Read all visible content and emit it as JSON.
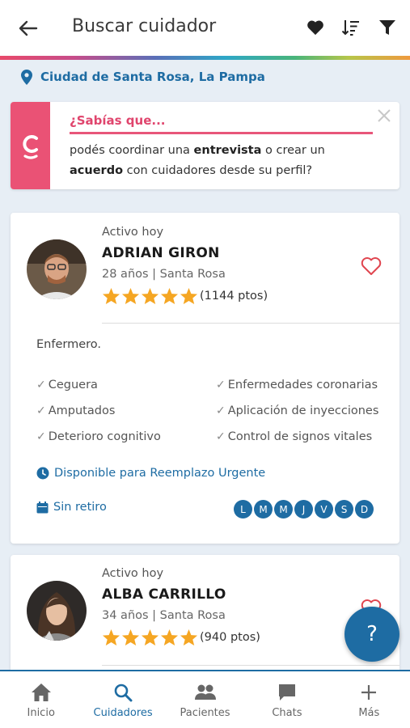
{
  "header": {
    "title": "Buscar cuidador",
    "back_icon": "arrow-left-icon",
    "icons": [
      "heart-icon",
      "sort-icon",
      "filter-icon"
    ]
  },
  "location": {
    "text": "Ciudad de Santa Rosa, La Pampa",
    "icon": "map-pin-icon"
  },
  "tip": {
    "title": "¿Sabías que...",
    "text_1": "podés coordinar una ",
    "bold_1": "entrevista",
    "text_2": " o crear un",
    "bold_2": "acuerdo",
    "text_3": " con cuidadores desde su perfil?",
    "brand_letter": "c"
  },
  "caregivers": [
    {
      "status": "Activo hoy",
      "name": "ADRIAN GIRON",
      "meta": "28 años | Santa Rosa",
      "rating": 5,
      "points": "(1144 ptos)",
      "profession": "Enfermero.",
      "skills_left": [
        "Ceguera",
        "Amputados",
        "Deterioro cognitivo"
      ],
      "skills_right": [
        "Enfermedades coronarias",
        "Aplicación de inyecciones",
        "Control de signos vitales"
      ],
      "urgent": "Disponible para Reemplazo Urgente",
      "retiro": "Sin retiro",
      "days": [
        "L",
        "M",
        "M",
        "J",
        "V",
        "S",
        "D"
      ]
    },
    {
      "status": "Activo hoy",
      "name": "ALBA CARRILLO",
      "meta": "34 años | Santa Rosa",
      "rating": 5,
      "points": "(940 ptos)"
    }
  ],
  "fab": {
    "label": "?"
  },
  "nav": [
    {
      "label": "Inicio",
      "icon": "home-icon",
      "active": false
    },
    {
      "label": "Cuidadores",
      "icon": "search-icon",
      "active": true
    },
    {
      "label": "Pacientes",
      "icon": "people-icon",
      "active": false
    },
    {
      "label": "Chats",
      "icon": "chat-icon",
      "active": false
    },
    {
      "label": "Más",
      "icon": "plus-icon",
      "active": false
    }
  ],
  "colors": {
    "primary": "#1e6ca3",
    "accent_pink": "#e0456d",
    "star": "#f5a623",
    "background": "#e7eef5"
  }
}
